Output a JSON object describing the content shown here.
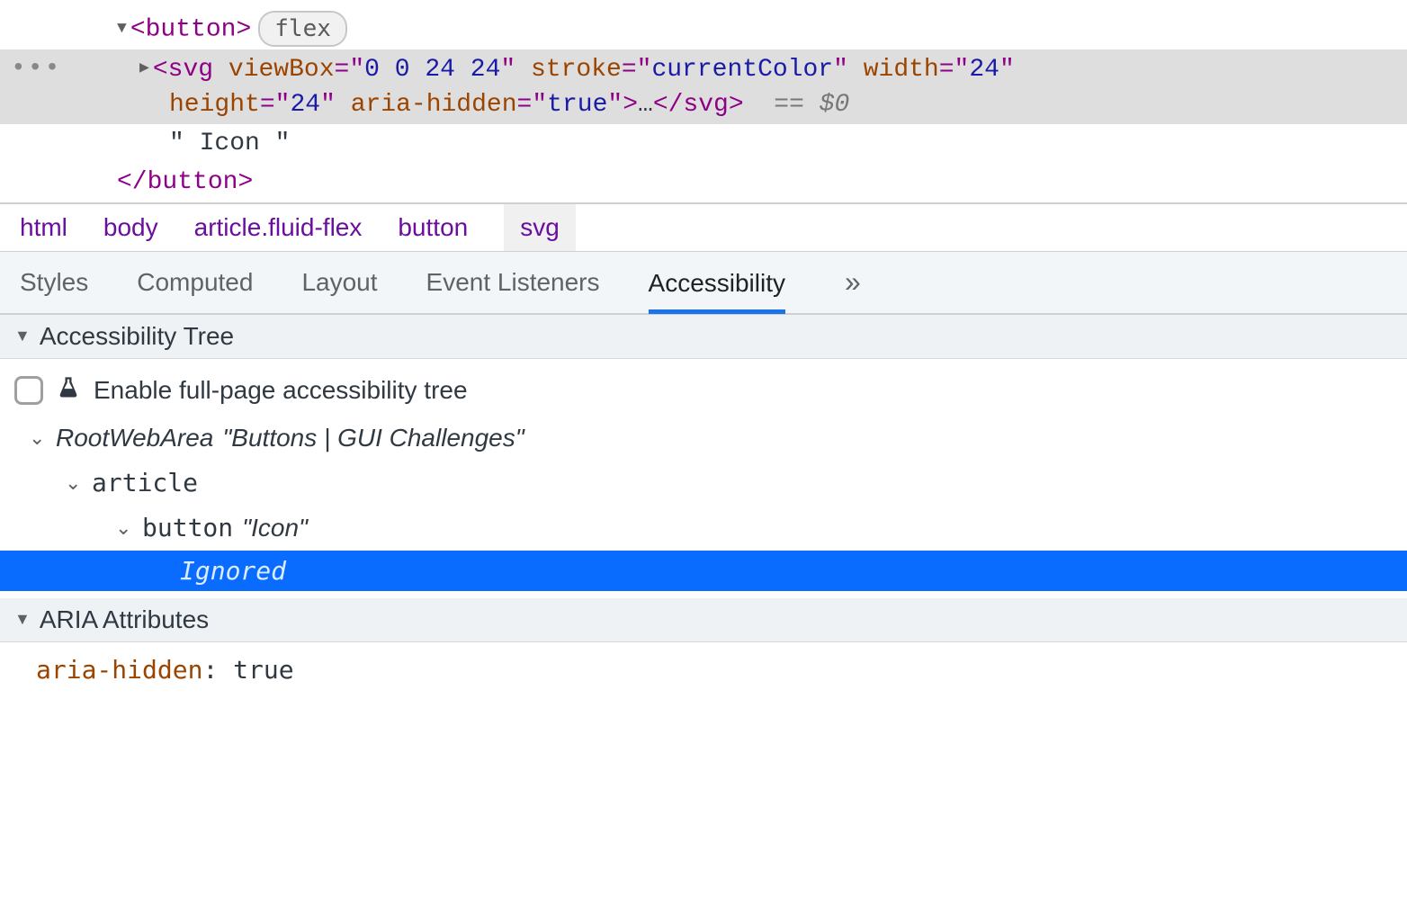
{
  "dom": {
    "button_open": "<button>",
    "button_close": "</button>",
    "flex_badge": "flex",
    "svg": {
      "tag": "svg",
      "attrs": [
        {
          "name": "viewBox",
          "value": "0 0 24 24"
        },
        {
          "name": "stroke",
          "value": "currentColor"
        },
        {
          "name": "width",
          "value": "24"
        },
        {
          "name": "height",
          "value": "24"
        },
        {
          "name": "aria-hidden",
          "value": "true"
        }
      ],
      "ref": "== $0"
    },
    "text_node": "\" Icon \""
  },
  "breadcrumb": [
    "html",
    "body",
    "article.fluid-flex",
    "button",
    "svg"
  ],
  "tabs": {
    "items": [
      "Styles",
      "Computed",
      "Layout",
      "Event Listeners",
      "Accessibility"
    ],
    "active": "Accessibility"
  },
  "acc_section": {
    "header": "Accessibility Tree",
    "enable_label": "Enable full-page accessibility tree",
    "tree": {
      "root_role": "RootWebArea",
      "root_name": "\"Buttons | GUI Challenges\"",
      "article_role": "article",
      "button_role": "button",
      "button_name": "\"Icon\"",
      "ignored": "Ignored"
    }
  },
  "aria_section": {
    "header": "ARIA Attributes",
    "attr_name": "aria-hidden",
    "attr_value": "true"
  }
}
